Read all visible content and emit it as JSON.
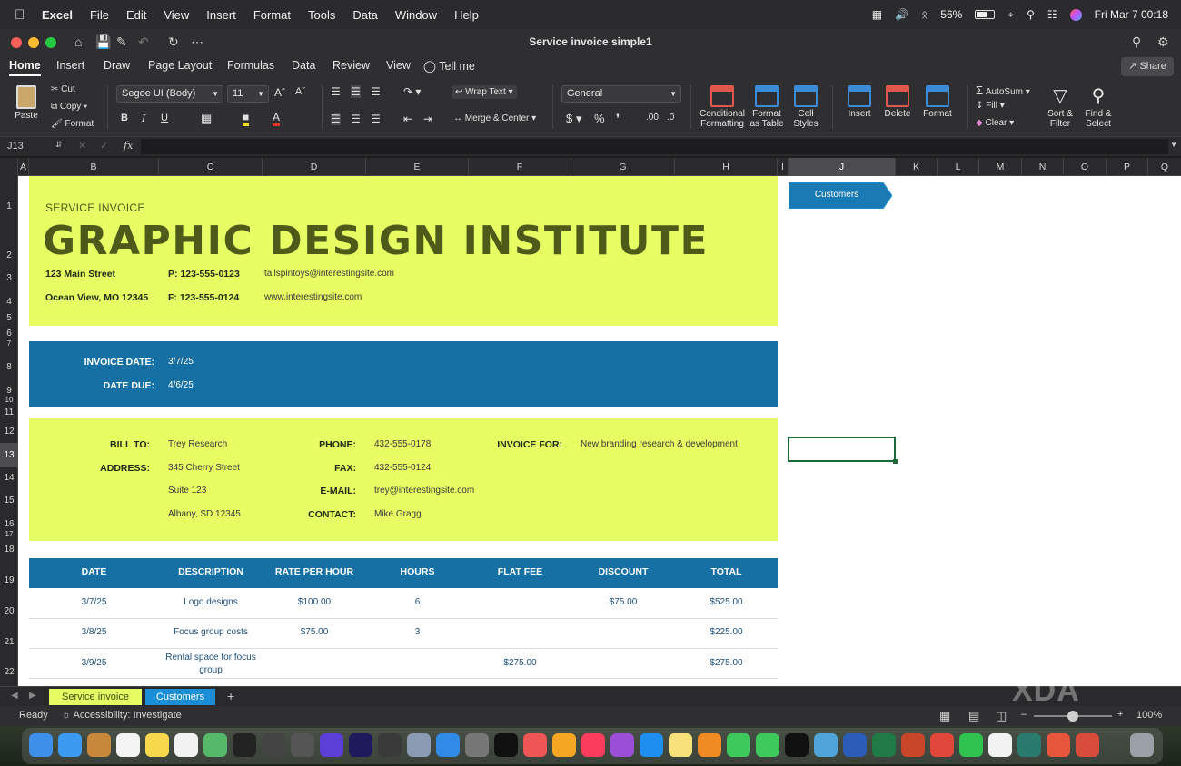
{
  "menubar": {
    "app": "Excel",
    "items": [
      "File",
      "Edit",
      "View",
      "Insert",
      "Format",
      "Tools",
      "Data",
      "Window",
      "Help"
    ],
    "battery": "56%",
    "datetime": "Fri Mar 7  00:18"
  },
  "window": {
    "title": "Service invoice simple1"
  },
  "ribbon_tabs": [
    "Home",
    "Insert",
    "Draw",
    "Page Layout",
    "Formulas",
    "Data",
    "Review",
    "View",
    "Tell me"
  ],
  "share_label": "Share",
  "ribbon": {
    "paste": "Paste",
    "cut": "Cut",
    "copy": "Copy",
    "format": "Format",
    "font_name": "Segoe UI (Body)",
    "font_size": "11",
    "wrap_text": "Wrap Text",
    "merge_center": "Merge & Center",
    "number_format": "General",
    "conditional_formatting": [
      "Conditional",
      "Formatting"
    ],
    "format_as_table": [
      "Format",
      "as Table"
    ],
    "cell_styles": [
      "Cell",
      "Styles"
    ],
    "insert": "Insert",
    "delete": "Delete",
    "format_cells": "Format",
    "autosum": "AutoSum",
    "fill": "Fill",
    "clear": "Clear",
    "sort_filter": [
      "Sort &",
      "Filter"
    ],
    "find_select": [
      "Find &",
      "Select"
    ]
  },
  "formula_bar": {
    "name_box": "J13",
    "fx": "fx",
    "content": ""
  },
  "columns": [
    "A",
    "B",
    "C",
    "D",
    "E",
    "F",
    "G",
    "H",
    "I",
    "J",
    "K",
    "L",
    "M",
    "N",
    "O",
    "P",
    "Q"
  ],
  "rows": [
    "1",
    "2",
    "3",
    "4",
    "5",
    "6",
    "7",
    "8",
    "9",
    "10",
    "11",
    "12",
    "13",
    "14",
    "15",
    "16",
    "17",
    "18",
    "19",
    "20",
    "21",
    "22"
  ],
  "invoice": {
    "kicker": "SERVICE INVOICE",
    "company": "GRAPHIC DESIGN INSTITUTE",
    "street": "123 Main Street",
    "city": "Ocean View, MO 12345",
    "phone": "P: 123-555-0123",
    "fax": "F: 123-555-0124",
    "email": "tailspintoys@interestingsite.com",
    "web": "www.interestingsite.com",
    "invoice_date_label": "INVOICE DATE:",
    "invoice_date": "3/7/25",
    "date_due_label": "DATE DUE:",
    "date_due": "4/6/25",
    "bill_to_label": "BILL TO:",
    "bill_to": "Trey Research",
    "address_label": "ADDRESS:",
    "address1": "345 Cherry Street",
    "address2": "Suite 123",
    "address3": "Albany, SD 12345",
    "phone_label": "PHONE:",
    "client_phone": "432-555-0178",
    "fax_label": "FAX:",
    "client_fax": "432-555-0124",
    "email_label": "E-MAIL:",
    "client_email": "trey@interestingsite.com",
    "contact_label": "CONTACT:",
    "contact": "Mike Gragg",
    "invoice_for_label": "INVOICE FOR:",
    "invoice_for": "New branding research & development",
    "table": {
      "headers": [
        "DATE",
        "DESCRIPTION",
        "RATE PER HOUR",
        "HOURS",
        "FLAT FEE",
        "DISCOUNT",
        "TOTAL"
      ],
      "rows": [
        [
          "3/7/25",
          "Logo designs",
          "$100.00",
          "6",
          "",
          "$75.00",
          "$525.00"
        ],
        [
          "3/8/25",
          "Focus group costs",
          "$75.00",
          "3",
          "",
          "",
          "$225.00"
        ],
        [
          "3/9/25",
          "Rental space for focus group",
          "",
          "",
          "$275.00",
          "",
          "$275.00"
        ]
      ]
    },
    "customers_button": "Customers"
  },
  "sheet_tabs": [
    "Service invoice",
    "Customers"
  ],
  "status": {
    "ready": "Ready",
    "accessibility": "Accessibility: Investigate",
    "zoom": "100%"
  },
  "watermark": "XDA",
  "colors": {
    "lime": "#e6fd64",
    "blue": "#1670a3",
    "olive": "#4d5a1a",
    "sheet_tab_active": "#e6fd64",
    "sheet_tab_customers": "#1a8fd8"
  }
}
